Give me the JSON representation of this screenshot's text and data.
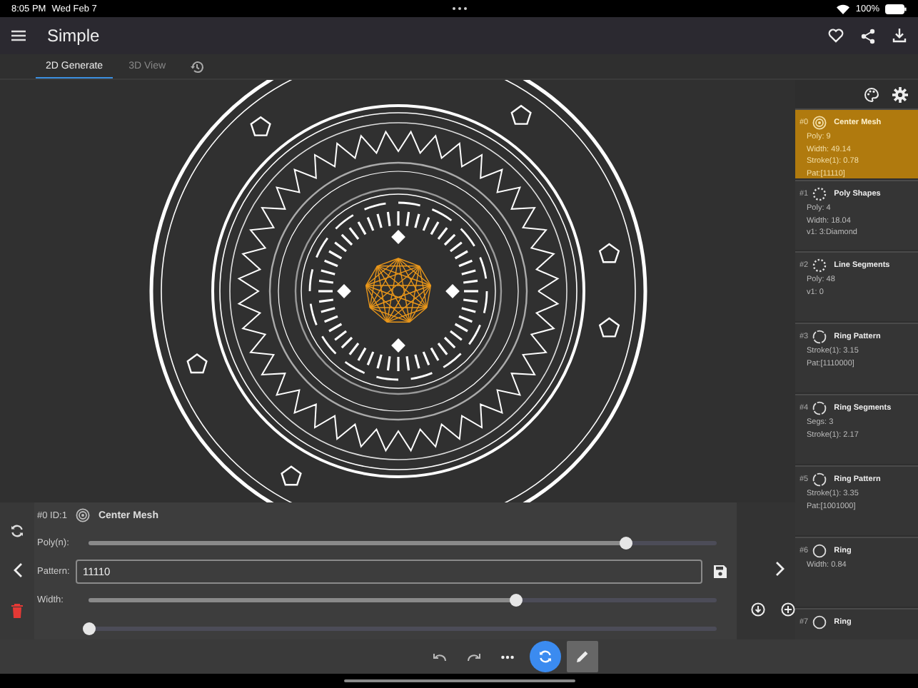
{
  "status_bar": {
    "time": "8:05 PM",
    "date": "Wed Feb 7",
    "battery": "100%"
  },
  "header": {
    "title": "Simple"
  },
  "tabs": [
    {
      "label": "2D Generate",
      "selected": true
    },
    {
      "label": "3D View",
      "selected": false
    }
  ],
  "layers": [
    {
      "index": "#0",
      "name": "Center Mesh",
      "kind": "mesh",
      "selected": true,
      "props": [
        "Poly: 9",
        "Width: 49.14",
        "Stroke(1): 0.78",
        "Pat:[11110]"
      ]
    },
    {
      "index": "#1",
      "name": "Poly Shapes",
      "kind": "dotted",
      "selected": false,
      "props": [
        "Poly: 4",
        "Width: 18.04",
        "v1: 3:Diamond"
      ]
    },
    {
      "index": "#2",
      "name": "Line Segments",
      "kind": "dotted",
      "selected": false,
      "props": [
        "Poly: 48",
        "v1: 0"
      ]
    },
    {
      "index": "#3",
      "name": "Ring Pattern",
      "kind": "dashed",
      "selected": false,
      "props": [
        "Stroke(1): 3.15",
        "Pat:[1110000]"
      ]
    },
    {
      "index": "#4",
      "name": "Ring Segments",
      "kind": "dashed",
      "selected": false,
      "props": [
        "Segs: 3",
        "Stroke(1): 2.17"
      ]
    },
    {
      "index": "#5",
      "name": "Ring Pattern",
      "kind": "dashed",
      "selected": false,
      "props": [
        "Stroke(1): 3.35",
        "Pat:[1001000]"
      ]
    },
    {
      "index": "#6",
      "name": "Ring",
      "kind": "ring",
      "selected": false,
      "props": [
        "Width: 0.84"
      ]
    },
    {
      "index": "#7",
      "name": "Ring",
      "kind": "ring",
      "selected": false
    }
  ],
  "editor": {
    "layer_id": "#0 ID:1",
    "layer_name": "Center Mesh",
    "rows": [
      {
        "kind": "slider",
        "label": "Poly(n):",
        "level": 0.856
      },
      {
        "kind": "field",
        "label": "Pattern:",
        "value": "11110"
      },
      {
        "kind": "slider",
        "label": "Width:",
        "level": 0.68
      },
      {
        "kind": "slider",
        "level": 0.0
      }
    ]
  },
  "toolbar": [
    {
      "kind": "undo"
    },
    {
      "kind": "redo"
    },
    {
      "kind": "more"
    },
    {
      "kind": "regenerate",
      "active": true
    },
    {
      "kind": "edit",
      "active": true
    }
  ]
}
